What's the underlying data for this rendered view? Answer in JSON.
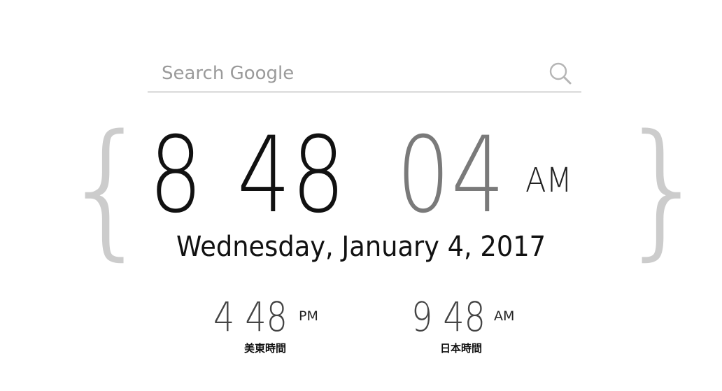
{
  "search": {
    "placeholder": "Search Google",
    "icon": "search-icon"
  },
  "braces": {
    "left": "{",
    "right": "}"
  },
  "clock": {
    "hours": "8",
    "minutes": "48",
    "seconds": "04",
    "ampm": "AM",
    "date": "Wednesday, January 4, 2017"
  },
  "world_clocks": [
    {
      "time": "4 48",
      "ampm": "PM",
      "label": "美東時間"
    },
    {
      "time": "9 48",
      "ampm": "AM",
      "label": "日本時間"
    }
  ],
  "colors": {
    "primary_text": "#111111",
    "seconds_text": "#7a7a7a",
    "brace": "#cccccc",
    "underline": "#999999",
    "placeholder": "#9a9a9a"
  }
}
